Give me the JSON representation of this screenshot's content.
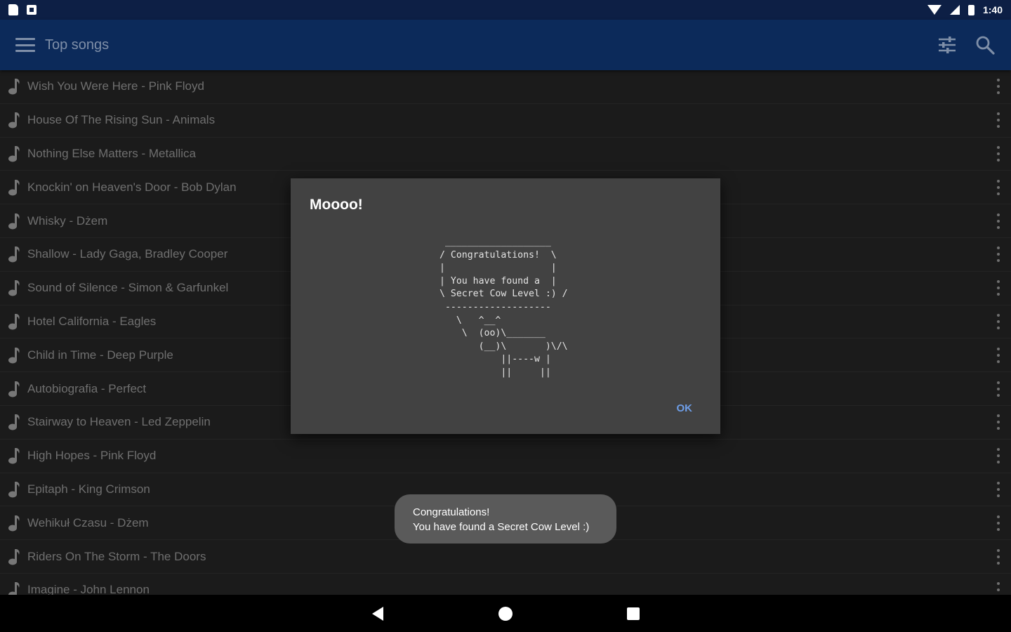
{
  "status_bar": {
    "time": "1:40"
  },
  "app_bar": {
    "title": "Top songs"
  },
  "songs": [
    "Wish You Were Here - Pink Floyd",
    "House Of The Rising Sun - Animals",
    "Nothing Else Matters - Metallica",
    "Knockin' on Heaven's Door - Bob Dylan",
    "Whisky - Dżem",
    "Shallow - Lady Gaga, Bradley Cooper",
    "Sound of Silence - Simon & Garfunkel",
    "Hotel California - Eagles",
    "Child in Time - Deep Purple",
    "Autobiografia - Perfect",
    "Stairway to Heaven - Led Zeppelin",
    "High Hopes - Pink Floyd",
    "Epitaph - King Crimson",
    "Wehikuł Czasu - Dżem",
    "Riders On The Storm - The Doors",
    "Imagine - John Lennon"
  ],
  "dialog": {
    "title": "Moooo!",
    "ascii_art": " ___________________\n/ Congratulations!  \\\n|                   |\n| You have found a  |\n\\ Secret Cow Level :) /\n -------------------\n   \\   ^__^\n    \\  (oo)\\_______\n       (__)\\       )\\/\\\n           ||----w |\n           ||     ||",
    "ok_label": "OK"
  },
  "toast": {
    "line1": "Congratulations!",
    "line2": "You have found a Secret Cow Level :)"
  },
  "colors": {
    "status_bar": "#0d1f45",
    "app_bar": "#0c2a5a",
    "background": "#1b1b1b",
    "dialog": "#424242",
    "accent": "#6e9ee8",
    "toast": "#5a5a5a"
  }
}
